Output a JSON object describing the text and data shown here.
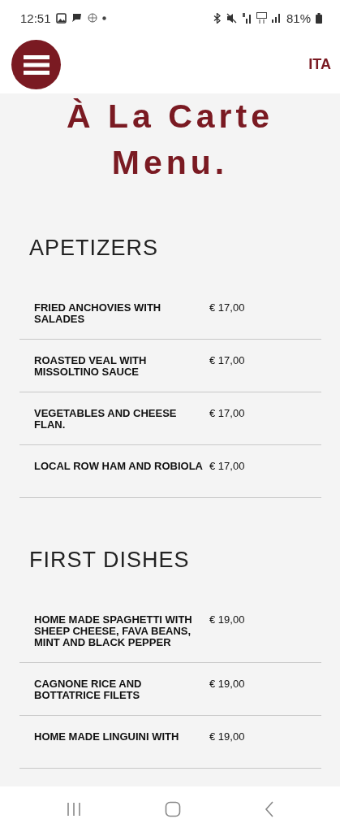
{
  "status_bar": {
    "time": "12:51",
    "battery": "81%"
  },
  "header": {
    "language": "ITA"
  },
  "title": "À La Carte Menu.",
  "sections": [
    {
      "title": "APETIZERS",
      "items": [
        {
          "name": "FRIED ANCHOVIES WITH SALADES",
          "price": "€ 17,00"
        },
        {
          "name": "ROASTED VEAL WITH MISSOLTINO SAUCE",
          "price": "€ 17,00"
        },
        {
          "name": "VEGETABLES AND CHEESE FLAN.",
          "price": "€ 17,00"
        },
        {
          "name": "LOCAL ROW HAM AND ROBIOLA",
          "price": "€ 17,00"
        }
      ]
    },
    {
      "title": "FIRST DISHES",
      "items": [
        {
          "name": "HOME MADE SPAGHETTI WITH SHEEP CHEESE, FAVA BEANS, MINT AND BLACK PEPPER",
          "price": "€ 19,00"
        },
        {
          "name": "CAGNONE RICE AND BOTTATRICE FILETS",
          "price": "€ 19,00"
        },
        {
          "name": "HOME MADE LINGUINI WITH",
          "price": "€ 19,00"
        }
      ]
    }
  ]
}
